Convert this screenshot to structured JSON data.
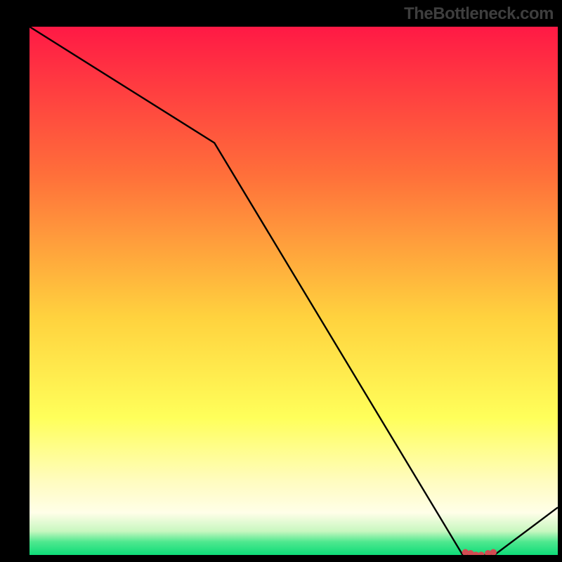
{
  "attribution": "TheBottleneck.com",
  "colors": {
    "bg": "#000000",
    "top_gradient": "#ff1945",
    "mid_upper": "#ff7a36",
    "mid": "#ffd240",
    "mid_lower": "#ffff66",
    "cream": "#fffdd0",
    "green": "#0ee87c",
    "line": "#000000",
    "marker_fill": "#d14c52",
    "marker_stroke": "#d14c52",
    "attribution_text": "#3e3e3e"
  },
  "chart_data": {
    "type": "line",
    "x": [
      0,
      0.35,
      0.82,
      0.88,
      1.0
    ],
    "values": [
      1.0,
      0.78,
      0.0,
      0.0,
      0.09
    ],
    "markers": {
      "x": [
        0.825,
        0.835,
        0.845,
        0.855,
        0.868,
        0.878
      ],
      "y": [
        0.005,
        0.003,
        0.0,
        0.0,
        0.003,
        0.005
      ]
    },
    "xlabel": "",
    "ylabel": "",
    "xlim": [
      0,
      1
    ],
    "ylim": [
      0,
      1
    ],
    "title": ""
  }
}
